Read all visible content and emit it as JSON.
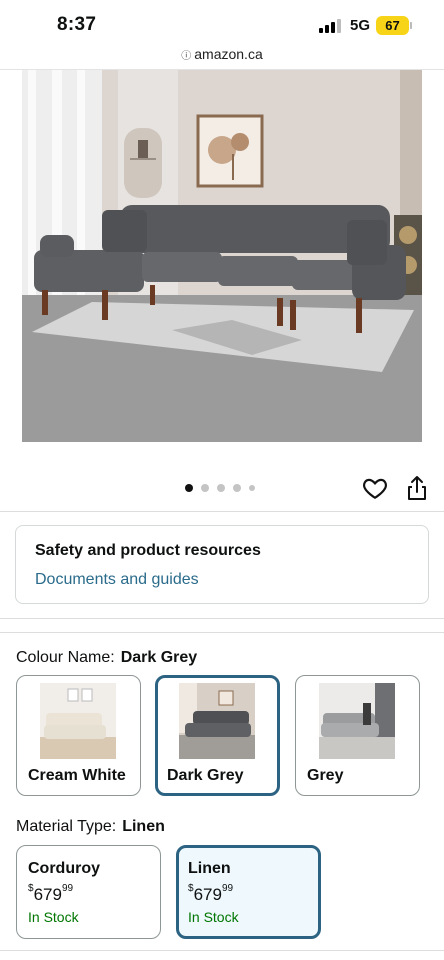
{
  "status": {
    "time": "8:37",
    "network": "5G",
    "battery": "67"
  },
  "browser": {
    "url": "amazon.ca"
  },
  "carousel": {
    "total": 5,
    "active": 0
  },
  "safety": {
    "title": "Safety and product resources",
    "link": "Documents and guides"
  },
  "colour": {
    "label": "Colour Name:",
    "selected": "Dark Grey",
    "options": [
      {
        "name": "Cream White",
        "sofa_color": "#e6e0d2"
      },
      {
        "name": "Dark Grey",
        "sofa_color": "#5f6063"
      },
      {
        "name": "Grey",
        "sofa_color": "#a9abad"
      }
    ]
  },
  "material": {
    "label": "Material Type:",
    "selected": "Linen",
    "options": [
      {
        "name": "Corduroy",
        "currency": "$",
        "price_whole": "679",
        "price_fraction": "99",
        "stock": "In Stock"
      },
      {
        "name": "Linen",
        "currency": "$",
        "price_whole": "679",
        "price_fraction": "99",
        "stock": "In Stock"
      }
    ]
  },
  "colors": {
    "link": "#2a6b8b",
    "selected_border": "#2d6382",
    "in_stock": "#007600",
    "battery": "#f7d417"
  }
}
